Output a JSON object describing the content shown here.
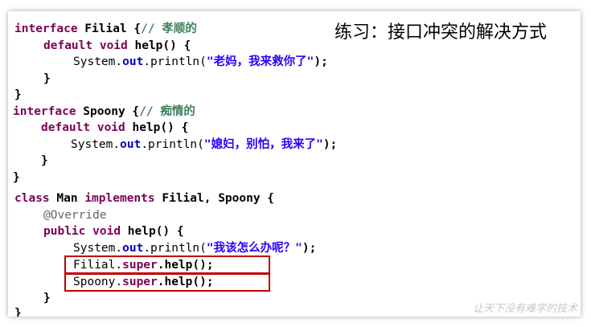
{
  "title": "练习：接口冲突的解决方式",
  "code": {
    "l1": {
      "kw1": "interface",
      "name": " Filial {",
      "comment": "// 孝顺的"
    },
    "l2": {
      "kw1": "default",
      "kw2": "void",
      "rest": " help() {"
    },
    "l3": {
      "pre": "System.",
      "field": "out",
      "mid": ".println(",
      "str": "\"老妈，我来救你了\"",
      "end": ");"
    },
    "l4": {
      "text": "}"
    },
    "l5": {
      "text": "}"
    },
    "l6": {
      "kw1": "interface",
      "name": " Spoony {",
      "comment": "// 痴情的"
    },
    "l7": {
      "kw1": "default",
      "kw2": "void",
      "rest": " help() {"
    },
    "l8": {
      "pre": "System.",
      "field": "out",
      "mid": ".println(",
      "str": "\"媳妇，别怕，我来了\"",
      "end": ");"
    },
    "l9": {
      "text": "}"
    },
    "l10": {
      "text": "}"
    },
    "l11": {
      "kw1": "class",
      "name": " Man ",
      "kw2": "implements",
      "rest": " Filial, Spoony {"
    },
    "l12": {
      "annotation": "@Override"
    },
    "l13": {
      "kw1": "public",
      "kw2": "void",
      "rest": " help() {"
    },
    "l14": {
      "pre": "System.",
      "field": "out",
      "mid": ".println(",
      "str": "\"我该怎么办呢？\"",
      "end": ");"
    },
    "l15": {
      "pre": "Filial.",
      "kw": "super",
      "end": ".help();"
    },
    "l16": {
      "pre": "Spoony.",
      "kw": "super",
      "end": ".help();"
    },
    "l17": {
      "text": "}"
    },
    "l18": {
      "text": "}"
    }
  },
  "watermark": "让天下没有难学的技术",
  "colors": {
    "keyword": "#7f0055",
    "comment": "#3f7f5f",
    "string": "#2a00ff",
    "field": "#0000c0",
    "annotation": "#646464",
    "highlight_box": "#c00000"
  }
}
